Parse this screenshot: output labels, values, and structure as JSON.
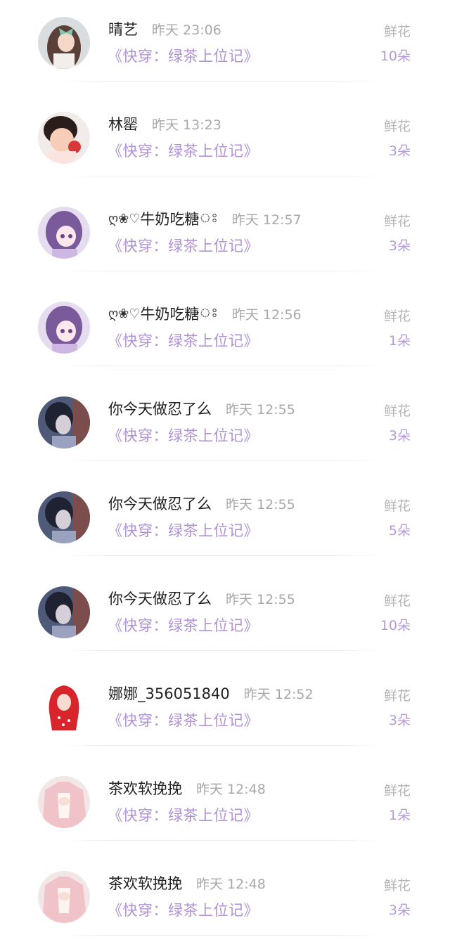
{
  "colors": {
    "name": "#222222",
    "time": "#a8a8a8",
    "book": "#b092d6",
    "flower_label": "#b5b5b5",
    "flower_count": "#b49bd6"
  },
  "rows": [
    {
      "name": "晴艺",
      "deco_left": "",
      "deco_right": "",
      "time": "昨天 23:06",
      "book": "《快穿：绿茶上位记》",
      "label": "鲜花",
      "count": "10朵",
      "avatar_icon": "girl-bow-avatar"
    },
    {
      "name": "林罂",
      "deco_left": "",
      "deco_right": "",
      "time": "昨天 13:23",
      "book": "《快穿：绿茶上位记》",
      "label": "鲜花",
      "count": "3朵",
      "avatar_icon": "child-avatar"
    },
    {
      "name": "牛奶吃糖",
      "deco_left": "ღ❀♡",
      "deco_right": "ঃ",
      "time": "昨天 12:57",
      "book": "《快穿：绿茶上位记》",
      "label": "鲜花",
      "count": "3朵",
      "avatar_icon": "anime-girl-avatar"
    },
    {
      "name": "牛奶吃糖",
      "deco_left": "ღ❀♡",
      "deco_right": "ঃ",
      "time": "昨天 12:56",
      "book": "《快穿：绿茶上位记》",
      "label": "鲜花",
      "count": "1朵",
      "avatar_icon": "anime-girl-avatar"
    },
    {
      "name": "你今天做忍了么",
      "deco_left": "",
      "deco_right": "",
      "time": "昨天 12:55",
      "book": "《快穿：绿茶上位记》",
      "label": "鲜花",
      "count": "3朵",
      "avatar_icon": "painted-woman-avatar"
    },
    {
      "name": "你今天做忍了么",
      "deco_left": "",
      "deco_right": "",
      "time": "昨天 12:55",
      "book": "《快穿：绿茶上位记》",
      "label": "鲜花",
      "count": "5朵",
      "avatar_icon": "painted-woman-avatar"
    },
    {
      "name": "你今天做忍了么",
      "deco_left": "",
      "deco_right": "",
      "time": "昨天 12:55",
      "book": "《快穿：绿茶上位记》",
      "label": "鲜花",
      "count": "10朵",
      "avatar_icon": "painted-woman-avatar"
    },
    {
      "name": "娜娜_356051840",
      "deco_left": "",
      "deco_right": "",
      "time": "昨天 12:52",
      "book": "《快穿：绿茶上位记》",
      "label": "鲜花",
      "count": "3朵",
      "avatar_icon": "red-hood-avatar"
    },
    {
      "name": "茶欢软挽挽",
      "deco_left": "",
      "deco_right": "",
      "time": "昨天 12:48",
      "book": "《快穿：绿茶上位记》",
      "label": "鲜花",
      "count": "1朵",
      "avatar_icon": "pink-coat-avatar"
    },
    {
      "name": "茶欢软挽挽",
      "deco_left": "",
      "deco_right": "",
      "time": "昨天 12:48",
      "book": "《快穿：绿茶上位记》",
      "label": "鲜花",
      "count": "3朵",
      "avatar_icon": "pink-coat-avatar"
    }
  ]
}
